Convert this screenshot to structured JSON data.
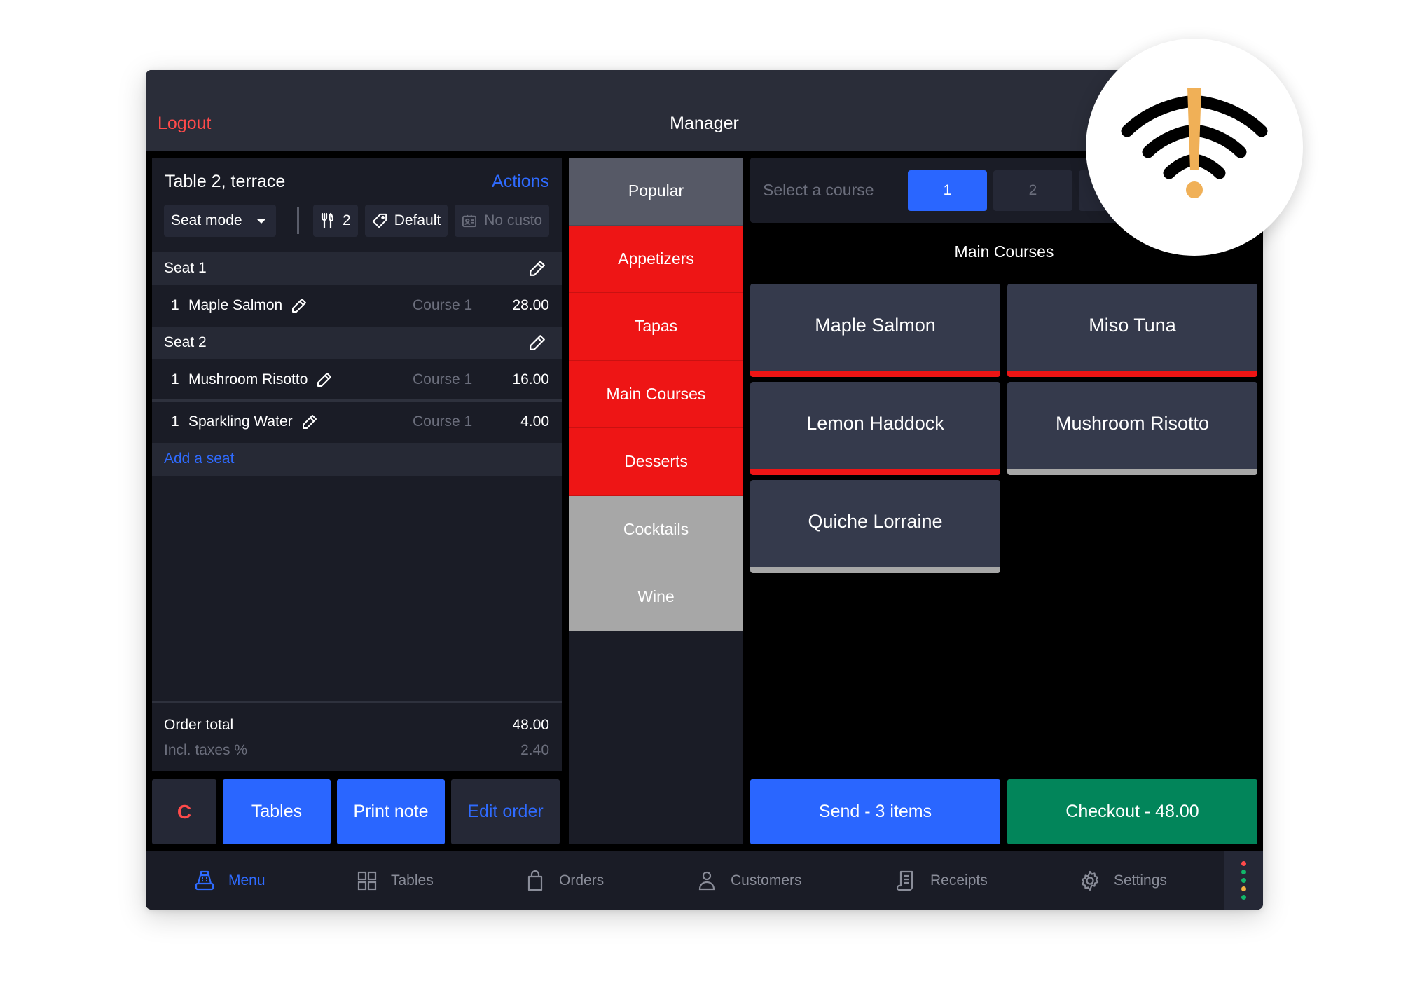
{
  "topbar": {
    "logout_label": "Logout",
    "title": "Manager"
  },
  "order": {
    "table_name": "Table 2, terrace",
    "actions_label": "Actions",
    "toolbar": {
      "seat_mode_label": "Seat mode",
      "guests_icon": "cutlery-icon",
      "guests_count": "2",
      "pricing_icon": "tag-icon",
      "pricing_label": "Default",
      "customer_icon": "id-card-icon",
      "customer_label": "No custo"
    },
    "seats": [
      {
        "label": "Seat 1",
        "items": [
          {
            "qty": "1",
            "name": "Maple Salmon",
            "course": "Course 1",
            "price": "28.00"
          }
        ]
      },
      {
        "label": "Seat 2",
        "items": [
          {
            "qty": "1",
            "name": "Mushroom Risotto",
            "course": "Course 1",
            "price": "16.00"
          },
          {
            "qty": "1",
            "name": "Sparkling Water",
            "course": "Course 1",
            "price": "4.00"
          }
        ]
      }
    ],
    "add_seat_label": "Add a seat",
    "total_label": "Order total",
    "total_value": "48.00",
    "tax_label": "Incl. taxes %",
    "tax_value": "2.40"
  },
  "order_actions": {
    "clear_label": "C",
    "tables_label": "Tables",
    "print_label": "Print note",
    "edit_label": "Edit order"
  },
  "categories": [
    {
      "label": "Popular",
      "style": "popular"
    },
    {
      "label": "Appetizers",
      "style": "red"
    },
    {
      "label": "Tapas",
      "style": "red"
    },
    {
      "label": "Main Courses",
      "style": "red"
    },
    {
      "label": "Desserts",
      "style": "red"
    },
    {
      "label": "Cocktails",
      "style": "grey"
    },
    {
      "label": "Wine",
      "style": "grey"
    }
  ],
  "course_selector": {
    "label": "Select a course",
    "options": [
      "1",
      "2"
    ],
    "selected": "1"
  },
  "products": {
    "section_title": "Main Courses",
    "items": [
      {
        "name": "Maple Salmon",
        "stripe": "red"
      },
      {
        "name": "Miso Tuna",
        "stripe": "red"
      },
      {
        "name": "Lemon Haddock",
        "stripe": "red"
      },
      {
        "name": "Mushroom Risotto",
        "stripe": "grey"
      },
      {
        "name": "Quiche Lorraine",
        "stripe": "grey"
      }
    ]
  },
  "footer_actions": {
    "send_label": "Send - 3 items",
    "checkout_label": "Checkout - 48.00"
  },
  "bottom_nav": [
    {
      "label": "Menu",
      "icon": "cash-register-icon",
      "active": true
    },
    {
      "label": "Tables",
      "icon": "tables-grid-icon",
      "active": false
    },
    {
      "label": "Orders",
      "icon": "shopping-bag-icon",
      "active": false
    },
    {
      "label": "Customers",
      "icon": "customers-icon",
      "active": false
    },
    {
      "label": "Receipts",
      "icon": "receipt-icon",
      "active": false
    },
    {
      "label": "Settings",
      "icon": "gear-icon",
      "active": false
    }
  ],
  "status_dots": [
    "#ff4a4a",
    "#12b76a",
    "#12b76a",
    "#f5b041",
    "#12b76a"
  ],
  "colors": {
    "accent_blue": "#2a66ff",
    "danger_red": "#ee1515",
    "checkout_green": "#02855a",
    "warning_orange": "#f0b057"
  },
  "offline_badge": {
    "icon": "wifi-warning-icon"
  }
}
